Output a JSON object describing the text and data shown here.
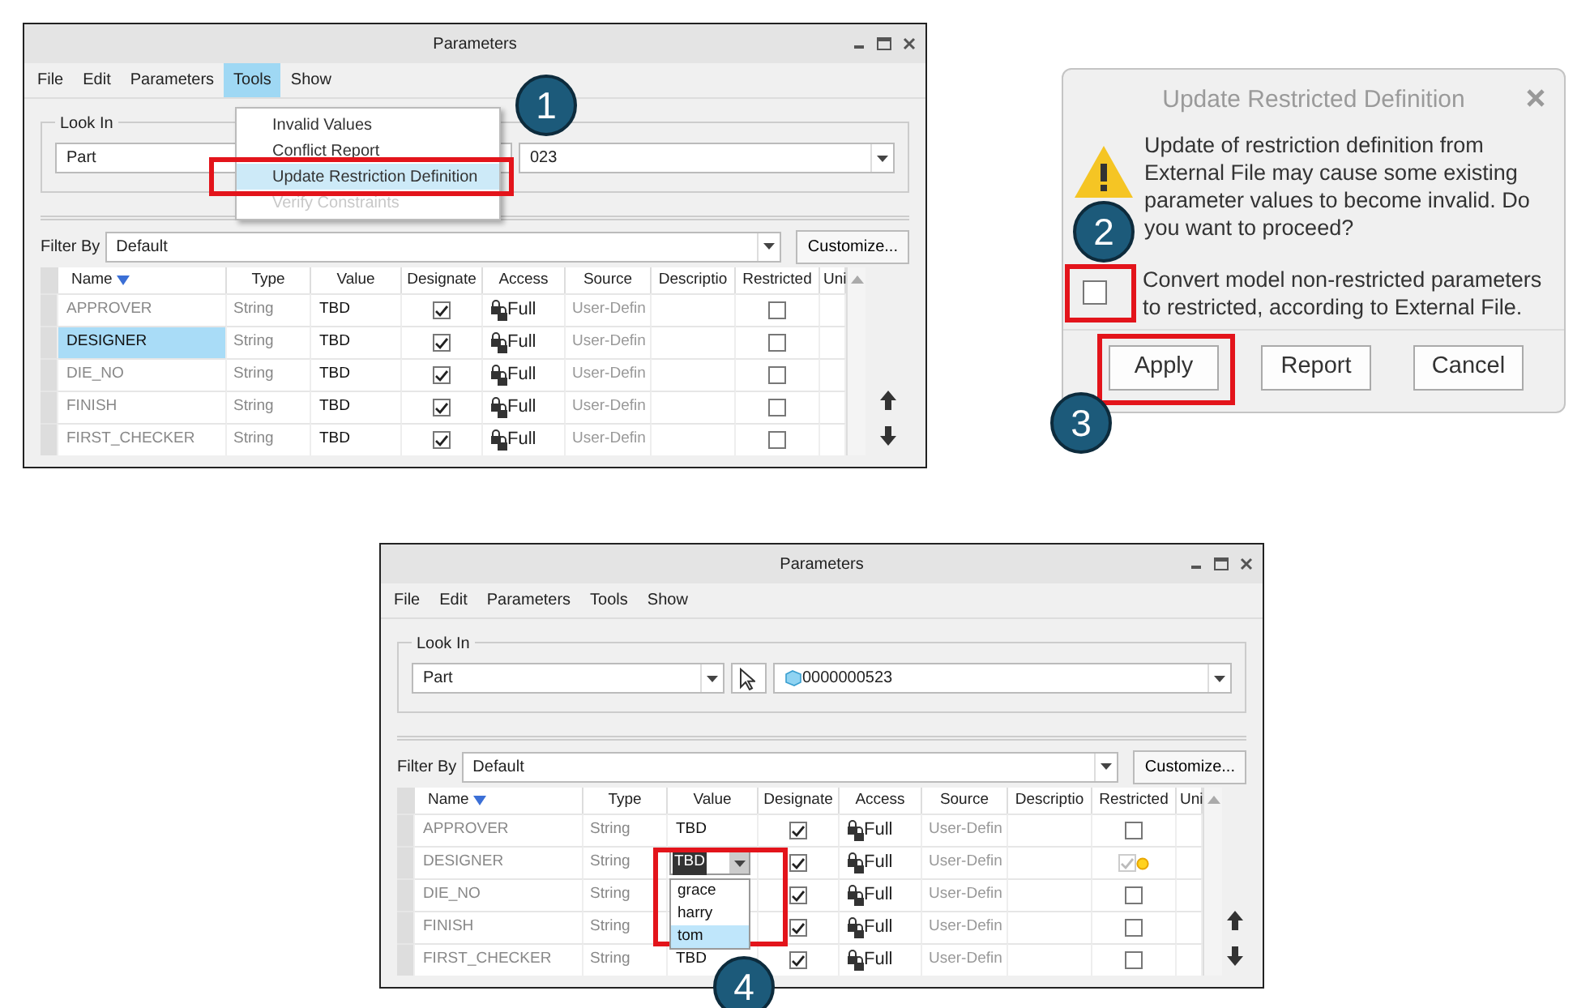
{
  "windows": [
    {
      "title": "Parameters",
      "menu": [
        {
          "label": "File",
          "selected": false
        },
        {
          "label": "Edit",
          "selected": false
        },
        {
          "label": "Parameters",
          "selected": false
        },
        {
          "label": "Tools",
          "selected": true
        },
        {
          "label": "Show",
          "selected": false
        }
      ],
      "open_menu": [
        {
          "label": "Invalid Values",
          "disabled": false,
          "selected": false
        },
        {
          "label": "Conflict Report",
          "disabled": false,
          "selected": false
        },
        {
          "label": "Update Restriction Definition",
          "disabled": false,
          "selected": true
        },
        {
          "label": "Verify Constraints",
          "disabled": true,
          "selected": false
        }
      ],
      "look_in": {
        "label": "Look In",
        "scope": "Part",
        "model": "023"
      },
      "filter": {
        "label": "Filter By",
        "value": "Default",
        "button": "Customize..."
      },
      "columns": [
        "Name",
        "Type",
        "Value",
        "Designate",
        "Access",
        "Source",
        "Descriptio",
        "Restricted",
        "Uni"
      ],
      "rows": [
        {
          "name": "APPROVER",
          "type": "String",
          "value": "TBD",
          "designate": true,
          "access": "Full",
          "source": "User-Defin",
          "restricted": false,
          "selected": false
        },
        {
          "name": "DESIGNER",
          "type": "String",
          "value": "TBD",
          "designate": true,
          "access": "Full",
          "source": "User-Defin",
          "restricted": false,
          "selected": true
        },
        {
          "name": "DIE_NO",
          "type": "String",
          "value": "TBD",
          "designate": true,
          "access": "Full",
          "source": "User-Defin",
          "restricted": false,
          "selected": false
        },
        {
          "name": "FINISH",
          "type": "String",
          "value": "TBD",
          "designate": true,
          "access": "Full",
          "source": "User-Defin",
          "restricted": false,
          "selected": false
        },
        {
          "name": "FIRST_CHECKER",
          "type": "String",
          "value": "TBD",
          "designate": true,
          "access": "Full",
          "source": "User-Defin",
          "restricted": false,
          "selected": false
        }
      ]
    },
    {
      "title": "Parameters",
      "menu": [
        {
          "label": "File",
          "selected": false
        },
        {
          "label": "Edit",
          "selected": false
        },
        {
          "label": "Parameters",
          "selected": false
        },
        {
          "label": "Tools",
          "selected": false
        },
        {
          "label": "Show",
          "selected": false
        }
      ],
      "look_in": {
        "label": "Look In",
        "scope": "Part",
        "scope_arrow": true,
        "pick_button": true,
        "model_icon": true,
        "model": "0000000523"
      },
      "filter": {
        "label": "Filter By",
        "value": "Default",
        "button": "Customize..."
      },
      "columns": [
        "Name",
        "Type",
        "Value",
        "Designate",
        "Access",
        "Source",
        "Descriptio",
        "Restricted",
        "Uni"
      ],
      "rows": [
        {
          "name": "APPROVER",
          "type": "String",
          "value": "TBD",
          "designate": true,
          "access": "Full",
          "source": "User-Defin",
          "restricted": false,
          "selected": false
        },
        {
          "name": "DESIGNER",
          "type": "String",
          "value": "TBD",
          "designate": true,
          "access": "Full",
          "source": "User-Defin",
          "restricted": true,
          "warning": true,
          "selected": false,
          "options": [
            {
              "label": "grace",
              "selected": false
            },
            {
              "label": "harry",
              "selected": false
            },
            {
              "label": "tom",
              "selected": true
            }
          ]
        },
        {
          "name": "DIE_NO",
          "type": "String",
          "designate": true,
          "access": "Full",
          "source": "User-Defin",
          "restricted": false,
          "selected": false
        },
        {
          "name": "FINISH",
          "type": "String",
          "designate": true,
          "access": "Full",
          "source": "User-Defin",
          "restricted": false,
          "selected": false
        },
        {
          "name": "FIRST_CHECKER",
          "type": "String",
          "value": "TBD",
          "designate": true,
          "access": "Full",
          "source": "User-Defin",
          "restricted": false,
          "selected": false
        }
      ]
    }
  ],
  "dialog": {
    "title": "Update Restricted Definition",
    "message": "Update of restriction definition from External File may cause some existing parameter values to become invalid. Do you want to proceed?",
    "checkbox": {
      "label": "Convert model non-restricted parameters to restricted, according to External File.",
      "checked": false
    },
    "buttons": [
      "Apply",
      "Report",
      "Cancel"
    ]
  },
  "callouts": [
    "1",
    "2",
    "3",
    "4"
  ]
}
